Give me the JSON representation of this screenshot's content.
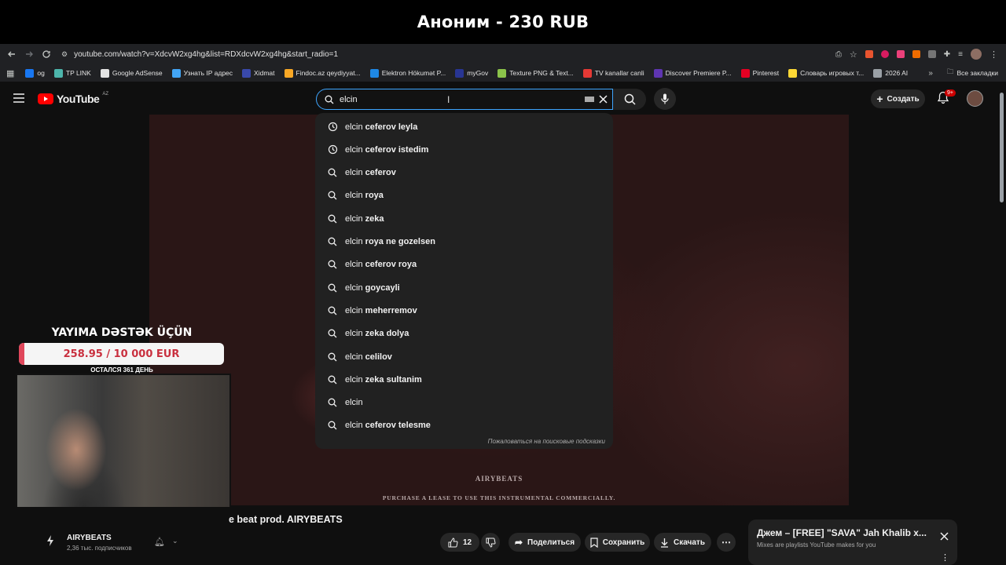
{
  "banner": {
    "title": "Аноним - 230 RUB"
  },
  "browser": {
    "url": "youtube.com/watch?v=XdcvW2xg4hg&list=RDXdcvW2xg4hg&start_radio=1",
    "bookmarks": [
      {
        "label": "og",
        "color": "#1877f2"
      },
      {
        "label": "TP LINK",
        "color": "#4db6ac"
      },
      {
        "label": "Google AdSense",
        "color": "#e3e3e3"
      },
      {
        "label": "Узнать IP адрес",
        "color": "#42a5f5"
      },
      {
        "label": "Xidmat",
        "color": "#3949ab"
      },
      {
        "label": "Findoc.az qeydiyyat...",
        "color": "#f9a825"
      },
      {
        "label": "Elektron Hökumət P...",
        "color": "#1e88e5"
      },
      {
        "label": "myGov",
        "color": "#283593"
      },
      {
        "label": "Texture PNG & Text...",
        "color": "#8bc34a"
      },
      {
        "label": "TV kanallar canli",
        "color": "#e53935"
      },
      {
        "label": "Discover Premiere P...",
        "color": "#5e35b1"
      },
      {
        "label": "Pinterest",
        "color": "#e60023"
      },
      {
        "label": "Словарь игровых т...",
        "color": "#fdd835"
      },
      {
        "label": "2026 AI",
        "color": "#9aa0a6"
      }
    ],
    "all_bookmarks": "Все закладки"
  },
  "youtube": {
    "logo": "YouTube",
    "region": "AZ",
    "search_value": "elcin",
    "create_label": "Создать",
    "notif_badge": "9+",
    "suggestions": [
      {
        "prefix": "elcin",
        "rest": " ceferov leyla",
        "icon": "history"
      },
      {
        "prefix": "elcin",
        "rest": " ceferov istedim",
        "icon": "history"
      },
      {
        "prefix": "elcin",
        "rest": " ceferov",
        "icon": "search"
      },
      {
        "prefix": "elcin",
        "rest": " roya",
        "icon": "search"
      },
      {
        "prefix": "elcin",
        "rest": " zeka",
        "icon": "search"
      },
      {
        "prefix": "elcin",
        "rest": " roya ne gozelsen",
        "icon": "search"
      },
      {
        "prefix": "elcin",
        "rest": " ceferov roya",
        "icon": "search"
      },
      {
        "prefix": "elcin",
        "rest": " goycayli",
        "icon": "search"
      },
      {
        "prefix": "elcin",
        "rest": " meherremov",
        "icon": "search"
      },
      {
        "prefix": "elcin",
        "rest": " zeka dolya",
        "icon": "search"
      },
      {
        "prefix": "elcin",
        "rest": " celilov",
        "icon": "search"
      },
      {
        "prefix": "elcin",
        "rest": " zeka sultanim",
        "icon": "search"
      },
      {
        "prefix": "elcin",
        "rest": "",
        "icon": "search"
      },
      {
        "prefix": "elcin",
        "rest": " ceferov telesme",
        "icon": "search"
      }
    ],
    "report_text": "Пожаловаться на поисковые подсказки",
    "video_watermark": "AIRYBEATS",
    "video_caption": "PURCHASE A LEASE TO USE THIS INSTRUMENTAL COMMERCIALLY.",
    "video_title": "e beat prod. AIRYBEATS",
    "channel_name": "AIRYBEATS",
    "channel_subs": "2,36 тыс. подписчиков",
    "likes": "12",
    "share_label": "Поделиться",
    "save_label": "Сохранить",
    "download_label": "Скачать",
    "mix_title": "Джем – [FREE] \"SAVA\" Jah Khalib x...",
    "mix_subtitle": "Mixes are playlists YouTube makes for you"
  },
  "overlay": {
    "donate_title": "YAYIMA DƏSTƏK ÜÇÜN",
    "donate_progress": "258.95 / 10 000 EUR",
    "donate_fraction": 0.0259,
    "days_left": "ОСТАЛСЯ 361 ДЕНЬ"
  }
}
